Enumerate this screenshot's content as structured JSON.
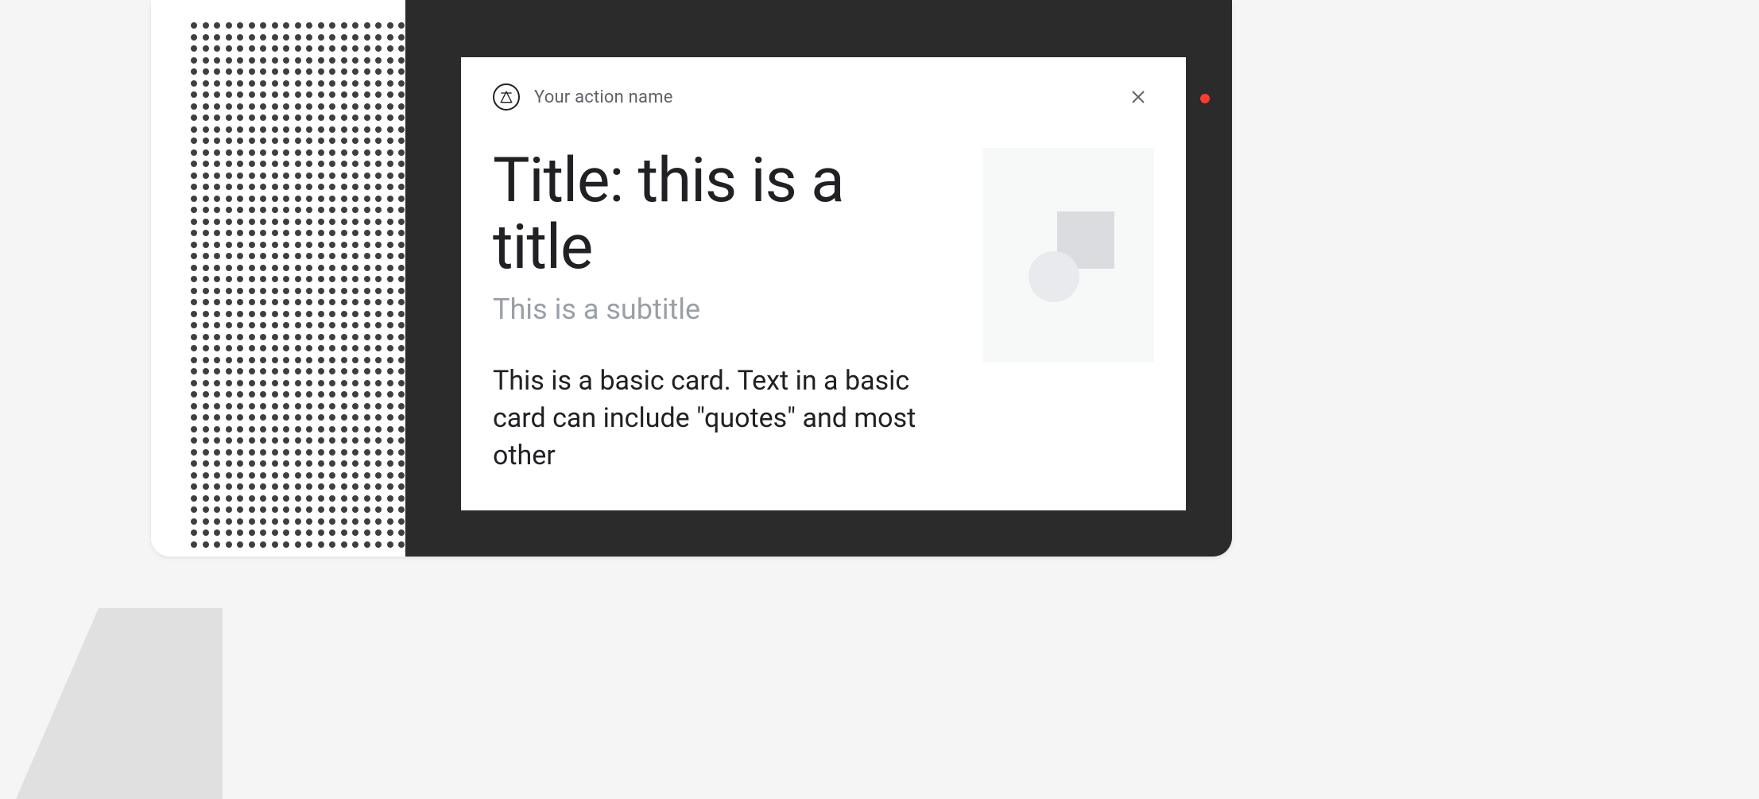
{
  "header": {
    "action_name": "Your action name",
    "close_label": "Close"
  },
  "card": {
    "title": "Title: this is a title",
    "subtitle": "This is a subtitle",
    "body": "This is a basic card. Text in a basic card can include \"quotes\" and most other"
  },
  "icons": {
    "action_logo": "material-logo-icon",
    "close": "close-icon",
    "image_placeholder": "image-placeholder-icon"
  },
  "colors": {
    "background": "#f5f5f5",
    "frame": "#2b2b2b",
    "card_bg": "#ffffff",
    "title_color": "#202124",
    "subtitle_color": "#9aa0a6",
    "led": "#ff3b30"
  }
}
